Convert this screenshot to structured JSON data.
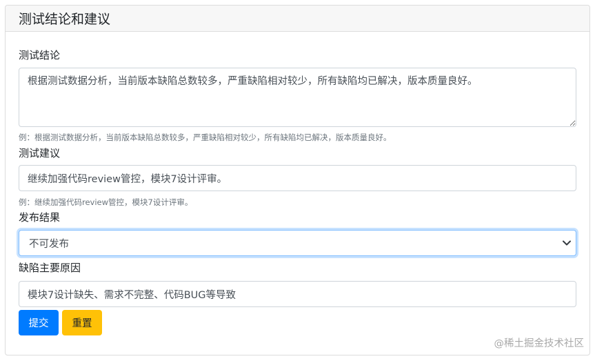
{
  "card": {
    "title": "测试结论和建议"
  },
  "conclusion": {
    "label": "测试结论",
    "value": "根据测试数据分析，当前版本缺陷总数较多，严重缺陷相对较少，所有缺陷均已解决，版本质量良好。",
    "help": "例：根据测试数据分析，当前版本缺陷总数较多，严重缺陷相对较少，所有缺陷均已解决，版本质量良好。"
  },
  "suggestion": {
    "label": "测试建议",
    "value": "继续加强代码review管控，模块7设计评审。",
    "help": "例：继续加强代码review管控，模块7设计评审。"
  },
  "release": {
    "label": "发布结果",
    "selected": "不可发布"
  },
  "defect_cause": {
    "label": "缺陷主要原因",
    "value": "模块7设计缺失、需求不完整、代码BUG等导致"
  },
  "buttons": {
    "submit": "提交",
    "reset": "重置"
  },
  "watermark": "@稀土掘金技术社区"
}
